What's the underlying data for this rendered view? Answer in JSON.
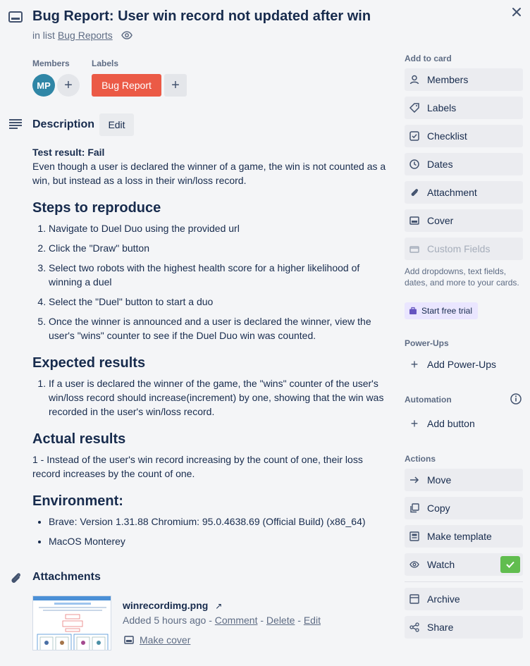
{
  "card": {
    "title": "Bug Report: User win record not updated after win",
    "in_list_prefix": "in list",
    "list_name": "Bug Reports"
  },
  "members": {
    "heading": "Members",
    "avatar_initials": "MP"
  },
  "labels": {
    "heading": "Labels",
    "items": [
      {
        "name": "Bug Report",
        "color": "#eb5a46"
      }
    ]
  },
  "description": {
    "heading": "Description",
    "edit_label": "Edit",
    "test_result": "Test result: Fail",
    "intro": "Even though a user is declared the winner of a game, the win is not counted as a win, but instead as a loss in their win/loss record.",
    "steps_heading": "Steps to reproduce",
    "steps": [
      "Navigate to Duel Duo using the provided url",
      "Click the \"Draw\" button",
      "Select two robots with the highest health score for a higher likelihood of winning a duel",
      "Select the \"Duel\" button to start a duo",
      "Once the winner is announced and a user is declared the winner, view the user's \"wins\" counter to see if the Duel Duo win was counted."
    ],
    "expected_heading": "Expected results",
    "expected": [
      "If a user is declared the winner of the game, the \"wins\" counter of the user's win/loss record should increase(increment) by one, showing that the win was recorded in the user's win/loss record."
    ],
    "actual_heading": "Actual results",
    "actual": "1 - Instead of the user's win record increasing by the count of one, their loss record increases by the count of one.",
    "env_heading": "Environment:",
    "env": [
      "Brave: Version 1.31.88 Chromium: 95.0.4638.69 (Official Build) (x86_64)",
      "MacOS Monterey"
    ]
  },
  "attachments": {
    "heading": "Attachments",
    "file_name": "winrecordimg.png",
    "added": "Added 5 hours ago",
    "sep": "-",
    "comment": "Comment",
    "delete": "Delete",
    "edit": "Edit",
    "make_cover": "Make cover"
  },
  "sidebar": {
    "add_to_card": {
      "heading": "Add to card",
      "items": [
        {
          "label": "Members",
          "icon": "person-icon"
        },
        {
          "label": "Labels",
          "icon": "tag-icon"
        },
        {
          "label": "Checklist",
          "icon": "checklist-icon"
        },
        {
          "label": "Dates",
          "icon": "clock-icon"
        },
        {
          "label": "Attachment",
          "icon": "paperclip-icon"
        },
        {
          "label": "Cover",
          "icon": "cover-icon"
        },
        {
          "label": "Custom Fields",
          "icon": "custom-fields-icon"
        }
      ],
      "custom_fields_desc": "Add dropdowns, text fields, dates, and more to your cards.",
      "trial_label": "Start free trial"
    },
    "power_ups": {
      "heading": "Power-Ups",
      "add_label": "Add Power-Ups"
    },
    "automation": {
      "heading": "Automation",
      "add_label": "Add button"
    },
    "actions": {
      "heading": "Actions",
      "items": [
        {
          "label": "Move",
          "icon": "arrow-right-icon"
        },
        {
          "label": "Copy",
          "icon": "copy-icon"
        },
        {
          "label": "Make template",
          "icon": "template-icon"
        },
        {
          "label": "Watch",
          "icon": "eye-icon"
        },
        {
          "label": "Archive",
          "icon": "archive-icon"
        },
        {
          "label": "Share",
          "icon": "share-icon"
        }
      ]
    }
  },
  "colors": {
    "label_red": "#eb5a46",
    "avatar": "#2f86a6",
    "watch_check": "#61bd4f",
    "trial_bg": "#eae6ff"
  }
}
